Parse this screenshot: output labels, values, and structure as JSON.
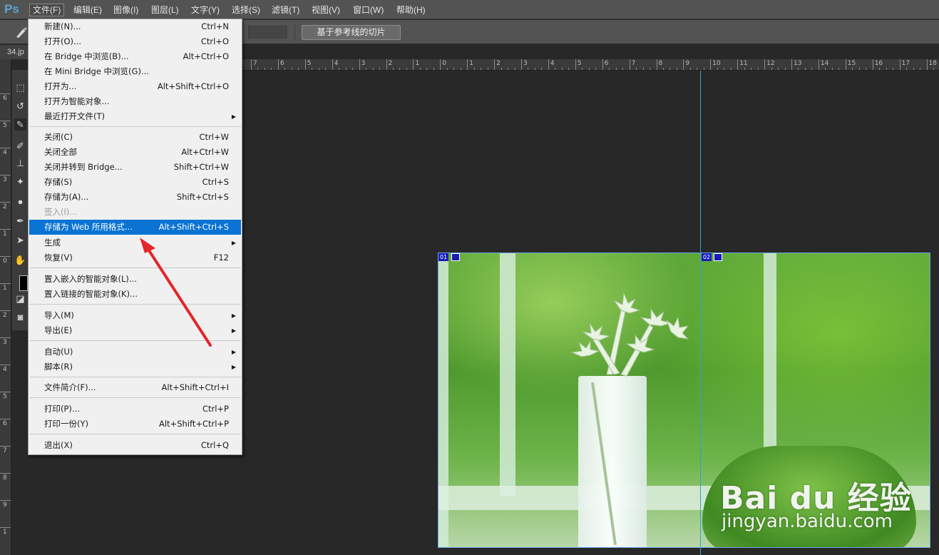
{
  "app": {
    "logo": "Ps"
  },
  "menubar": {
    "items": [
      "文件(F)",
      "编辑(E)",
      "图像(I)",
      "图层(L)",
      "文字(Y)",
      "选择(S)",
      "滤镜(T)",
      "视图(V)",
      "窗口(W)",
      "帮助(H)"
    ],
    "active": "文件(F)"
  },
  "options": {
    "slice_from_guides_button": "基于参考线的切片"
  },
  "document": {
    "tab_label": "34.jp"
  },
  "ruler": {
    "top_labels": [
      "7",
      "6",
      "5",
      "4",
      "3",
      "2",
      "1",
      "0",
      "1",
      "2",
      "3",
      "4",
      "5",
      "6",
      "7",
      "8",
      "9",
      "10",
      "11",
      "12",
      "13",
      "14",
      "15",
      "16",
      "17",
      "18"
    ],
    "left_labels": [
      "6",
      "5",
      "4",
      "3",
      "2",
      "1",
      "0",
      "1",
      "2",
      "3",
      "4",
      "5",
      "6",
      "7",
      "8",
      "9",
      "1"
    ]
  },
  "file_menu": {
    "items": [
      {
        "label": "新建(N)...",
        "shortcut": "Ctrl+N"
      },
      {
        "label": "打开(O)...",
        "shortcut": "Ctrl+O"
      },
      {
        "label": "在 Bridge 中浏览(B)...",
        "shortcut": "Alt+Ctrl+O"
      },
      {
        "label": "在 Mini Bridge 中浏览(G)...",
        "shortcut": ""
      },
      {
        "label": "打开为...",
        "shortcut": "Alt+Shift+Ctrl+O"
      },
      {
        "label": "打开为智能对象...",
        "shortcut": ""
      },
      {
        "label": "最近打开文件(T)",
        "shortcut": ""
      },
      {
        "label": "关闭(C)",
        "shortcut": "Ctrl+W"
      },
      {
        "label": "关闭全部",
        "shortcut": "Alt+Ctrl+W"
      },
      {
        "label": "关闭并转到 Bridge...",
        "shortcut": "Shift+Ctrl+W"
      },
      {
        "label": "存储(S)",
        "shortcut": "Ctrl+S"
      },
      {
        "label": "存储为(A)...",
        "shortcut": "Shift+Ctrl+S"
      },
      {
        "label": "签入(I)...",
        "shortcut": ""
      },
      {
        "label": "存储为 Web 所用格式...",
        "shortcut": "Alt+Shift+Ctrl+S"
      },
      {
        "label": "生成",
        "shortcut": ""
      },
      {
        "label": "恢复(V)",
        "shortcut": "F12"
      },
      {
        "label": "置入嵌入的智能对象(L)...",
        "shortcut": ""
      },
      {
        "label": "置入链接的智能对象(K)...",
        "shortcut": ""
      },
      {
        "label": "导入(M)",
        "shortcut": ""
      },
      {
        "label": "导出(E)",
        "shortcut": ""
      },
      {
        "label": "自动(U)",
        "shortcut": ""
      },
      {
        "label": "脚本(R)",
        "shortcut": ""
      },
      {
        "label": "文件简介(F)...",
        "shortcut": "Alt+Shift+Ctrl+I"
      },
      {
        "label": "打印(P)...",
        "shortcut": "Ctrl+P"
      },
      {
        "label": "打印一份(Y)",
        "shortcut": "Alt+Shift+Ctrl+P"
      },
      {
        "label": "退出(X)",
        "shortcut": "Ctrl+Q"
      }
    ],
    "highlighted": "存储为 Web 所用格式...",
    "disabled": "签入(I)..."
  },
  "slices": [
    "01",
    "02"
  ],
  "watermark": {
    "brand": "Bai du 经验",
    "url": "jingyan.baidu.com"
  },
  "colors": {
    "highlight": "#0a73d3",
    "guide": "#27a6d8",
    "annotation_arrow": "#e3262b",
    "slice_badge": "#1a1ab8"
  }
}
